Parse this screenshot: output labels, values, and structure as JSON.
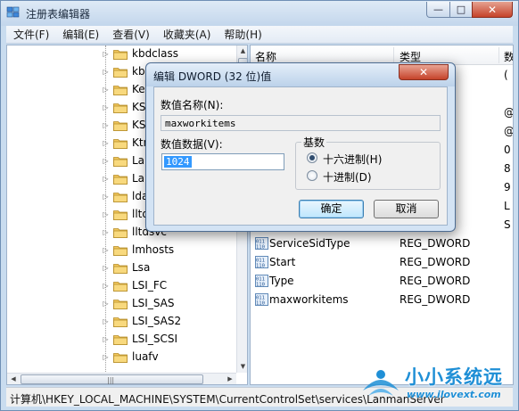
{
  "window": {
    "title": "注册表编辑器",
    "minimize_glyph": "—",
    "maximize_glyph": "□",
    "close_glyph": "✕"
  },
  "menu": [
    "文件(F)",
    "编辑(E)",
    "查看(V)",
    "收藏夹(A)",
    "帮助(H)"
  ],
  "tree": {
    "items": [
      "kbdclass",
      "kbdhid",
      "KeyIso",
      "KSecDD",
      "KSecPkg",
      "KtmRm",
      "LanmanServer",
      "LanmanWorkstation",
      "ldap",
      "lltdio",
      "lltdsvc",
      "lmhosts",
      "Lsa",
      "LSI_FC",
      "LSI_SAS",
      "LSI_SAS2",
      "LSI_SCSI",
      "luafv"
    ],
    "expander_glyph": "▷",
    "hscroll_grip": "|||"
  },
  "list": {
    "columns": [
      "名称",
      "类型",
      "数"
    ],
    "rows": [
      {
        "name": "",
        "type": "",
        "data": "(",
        "icon": "ab-string-icon"
      },
      {
        "name": "",
        "type": "TI_SZ",
        "data": "",
        "icon": "ab-string-icon"
      },
      {
        "name": "",
        "type": "",
        "data": "@",
        "icon": "ab-string-icon"
      },
      {
        "name": "",
        "type": "",
        "data": "@",
        "icon": "ab-string-icon"
      },
      {
        "name": "",
        "type": "DWORD",
        "data": "0",
        "icon": "dword-icon"
      },
      {
        "name": "",
        "type": "RY",
        "data": "8",
        "icon": "binary-icon"
      },
      {
        "name": "",
        "type": "ND_SZ",
        "data": "9",
        "icon": "ab-string-icon"
      },
      {
        "name": "",
        "type": "",
        "data": "L",
        "icon": "ab-string-icon"
      },
      {
        "name": "",
        "type": "TI_SZ",
        "data": "S",
        "icon": "ab-string-icon"
      },
      {
        "name": "ServiceSidType",
        "type": "REG_DWORD",
        "data": "",
        "icon": "dword-icon"
      },
      {
        "name": "Start",
        "type": "REG_DWORD",
        "data": "",
        "icon": "dword-icon"
      },
      {
        "name": "Type",
        "type": "REG_DWORD",
        "data": "",
        "icon": "dword-icon"
      },
      {
        "name": "maxworkitems",
        "type": "REG_DWORD",
        "data": "",
        "icon": "dword-icon"
      }
    ]
  },
  "status": {
    "path": "计算机\\HKEY_LOCAL_MACHINE\\SYSTEM\\CurrentControlSet\\services\\LanmanServer"
  },
  "watermark": {
    "brand": "小小系统远",
    "url": "www.ilovext.com"
  },
  "dialog": {
    "title": "编辑 DWORD (32 位)值",
    "close_glyph": "✕",
    "name_label": "数值名称(N):",
    "name_value": "maxworkitems",
    "data_label": "数值数据(V):",
    "data_value": "1024",
    "base_label": "基数",
    "radio_hex": "十六进制(H)",
    "radio_dec": "十进制(D)",
    "selected_base": "hex",
    "ok_label": "确定",
    "cancel_label": "取消"
  }
}
